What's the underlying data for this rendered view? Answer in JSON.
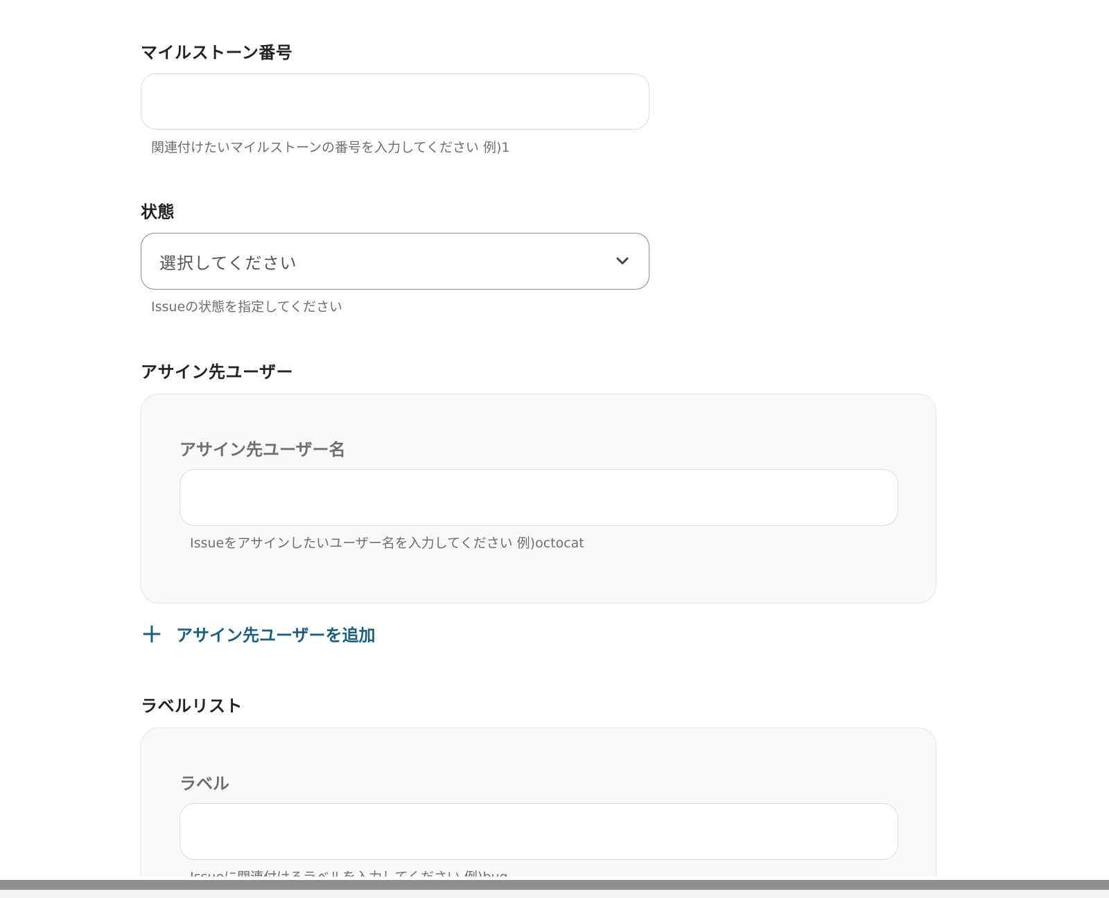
{
  "milestone": {
    "label": "マイルストーン番号",
    "value": "",
    "help": "関連付けたいマイルストーンの番号を入力してください 例)1"
  },
  "state": {
    "label": "状態",
    "placeholder": "選択してください",
    "help": "Issueの状態を指定してください",
    "icon": "chevron-down"
  },
  "assignees": {
    "label": "アサイン先ユーザー",
    "item_label": "アサイン先ユーザー名",
    "value": "",
    "help": "Issueをアサインしたいユーザー名を入力してください 例)octocat",
    "add_label": "アサイン先ユーザーを追加",
    "add_icon": "plus"
  },
  "labels": {
    "label": "ラベルリスト",
    "item_label": "ラベル",
    "value": "",
    "help": "Issueに関連付けるラベルを入力してください 例)bug"
  },
  "colors": {
    "link": "#1b5f7e",
    "help_text": "#6b6f73",
    "group_bg": "#f9f9f9"
  }
}
